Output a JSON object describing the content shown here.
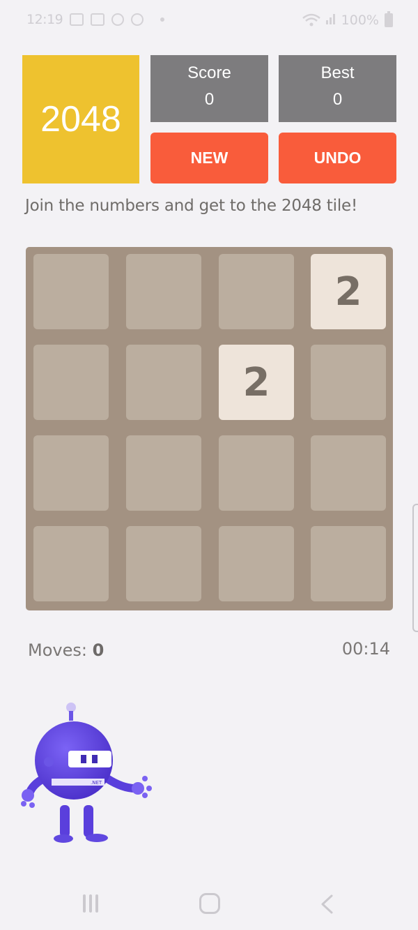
{
  "status_bar": {
    "time": "12:19",
    "battery": "100%"
  },
  "header": {
    "logo": "2048",
    "score_label": "Score",
    "score_value": "0",
    "best_label": "Best",
    "best_value": "0",
    "new_button": "NEW",
    "undo_button": "UNDO"
  },
  "tagline": "Join the numbers and get to the 2048 tile!",
  "board": {
    "rows": [
      [
        "",
        "",
        "",
        "2"
      ],
      [
        "",
        "",
        "2",
        ""
      ],
      [
        "",
        "",
        "",
        ""
      ],
      [
        "",
        "",
        "",
        ""
      ]
    ]
  },
  "footer": {
    "moves_label": "Moves:",
    "moves_value": "0",
    "timer": "00:14"
  },
  "mascot": {
    "badge": ".NET"
  },
  "colors": {
    "logo": "#eec22f",
    "score_box": "#7d7c7e",
    "button": "#f95c3b",
    "board": "#a39282",
    "empty_cell": "#bbae9f",
    "tile_2": "#eee4da"
  }
}
